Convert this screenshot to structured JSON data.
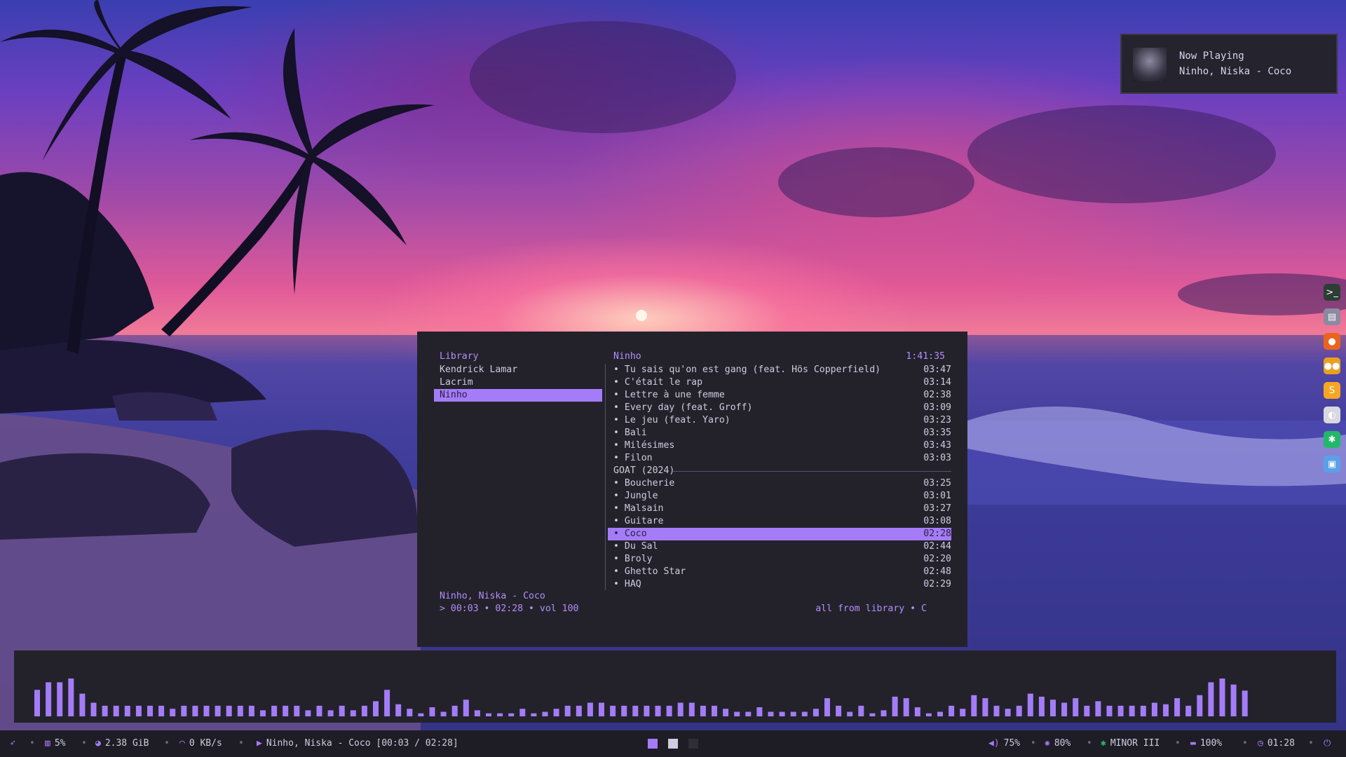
{
  "notification": {
    "title": "Now Playing",
    "body": "Ninho, Niska - Coco"
  },
  "player": {
    "library_title": "Library",
    "artists": [
      {
        "name": "Kendrick Lamar",
        "selected": false
      },
      {
        "name": "Lacrim",
        "selected": false
      },
      {
        "name": "Ninho",
        "selected": true
      }
    ],
    "tracks_header": {
      "artist": "Ninho",
      "total_duration": "1:41:35"
    },
    "tracks": [
      {
        "title": "• Tu sais qu'on est gang (feat. Hös Copperfield)",
        "duration": "03:47"
      },
      {
        "title": "• C'était le rap",
        "duration": "03:14"
      },
      {
        "title": "• Lettre à une femme",
        "duration": "02:38"
      },
      {
        "title": "• Every day (feat. Groff)",
        "duration": "03:09"
      },
      {
        "title": "• Le jeu (feat. Yaro)",
        "duration": "03:23"
      },
      {
        "title": "• Bali",
        "duration": "03:35"
      },
      {
        "title": "• Milésimes",
        "duration": "03:43"
      },
      {
        "title": "• Filon",
        "duration": "03:03"
      },
      {
        "album": "GOAT (2024)"
      },
      {
        "title": "• Boucherie",
        "duration": "03:25"
      },
      {
        "title": "• Jungle",
        "duration": "03:01"
      },
      {
        "title": "• Malsain",
        "duration": "03:27"
      },
      {
        "title": "• Guitare",
        "duration": "03:08"
      },
      {
        "title": "• Coco",
        "duration": "02:28",
        "selected": true
      },
      {
        "title": "• Du Sal",
        "duration": "02:44"
      },
      {
        "title": "• Broly",
        "duration": "02:20"
      },
      {
        "title": "• Ghetto Star",
        "duration": "02:48"
      },
      {
        "title": "• HAQ",
        "duration": "02:29"
      }
    ],
    "now_playing": "Ninho, Niska - Coco",
    "status": "> 00:03 • 02:28 • vol 100",
    "mode": "all from library • C"
  },
  "visualizer": {
    "color": "#a47cf8",
    "levels": [
      0.35,
      0.45,
      0.45,
      0.5,
      0.3,
      0.18,
      0.14,
      0.14,
      0.14,
      0.14,
      0.14,
      0.14,
      0.1,
      0.14,
      0.14,
      0.14,
      0.14,
      0.14,
      0.14,
      0.14,
      0.08,
      0.14,
      0.14,
      0.14,
      0.08,
      0.14,
      0.08,
      0.14,
      0.08,
      0.14,
      0.2,
      0.35,
      0.16,
      0.1,
      0.04,
      0.12,
      0.06,
      0.14,
      0.22,
      0.08,
      0.04,
      0.04,
      0.04,
      0.1,
      0.04,
      0.06,
      0.1,
      0.14,
      0.14,
      0.18,
      0.18,
      0.14,
      0.14,
      0.14,
      0.14,
      0.14,
      0.14,
      0.18,
      0.18,
      0.14,
      0.14,
      0.1,
      0.06,
      0.06,
      0.12,
      0.06,
      0.06,
      0.06,
      0.06,
      0.1,
      0.24,
      0.14,
      0.06,
      0.14,
      0.04,
      0.08,
      0.26,
      0.24,
      0.12,
      0.04,
      0.06,
      0.14,
      0.1,
      0.28,
      0.24,
      0.14,
      0.1,
      0.14,
      0.3,
      0.26,
      0.22,
      0.18,
      0.24,
      0.14,
      0.2,
      0.14,
      0.14,
      0.14,
      0.14,
      0.18,
      0.16,
      0.24,
      0.14,
      0.28,
      0.45,
      0.5,
      0.42,
      0.34
    ]
  },
  "statusbar": {
    "cpu": "5%",
    "memory": "2.38 GiB",
    "network": "0 KB/s",
    "media": "Ninho, Niska - Coco [00:03 / 02:28]",
    "volume": "75%",
    "brightness": "80%",
    "bluetooth": "MINOR III",
    "battery": "100%",
    "time": "01:28"
  },
  "dock": [
    {
      "name": "terminal-icon",
      "glyph": ">_",
      "color": "#2c3e34"
    },
    {
      "name": "editor-icon",
      "glyph": "▤",
      "color": "#8a8aa0"
    },
    {
      "name": "firefox-icon",
      "glyph": "●",
      "color": "#e8641f"
    },
    {
      "name": "gamepad-icon",
      "glyph": "●●",
      "color": "#e8a020"
    },
    {
      "name": "sublime-text-icon",
      "glyph": "S",
      "color": "#f5a623"
    },
    {
      "name": "steam-icon",
      "glyph": "◐",
      "color": "#d8d8e0"
    },
    {
      "name": "bluetooth-manager-icon",
      "glyph": "✱",
      "color": "#22b86a"
    },
    {
      "name": "file-manager-icon",
      "glyph": "▣",
      "color": "#5aa0e8"
    }
  ]
}
